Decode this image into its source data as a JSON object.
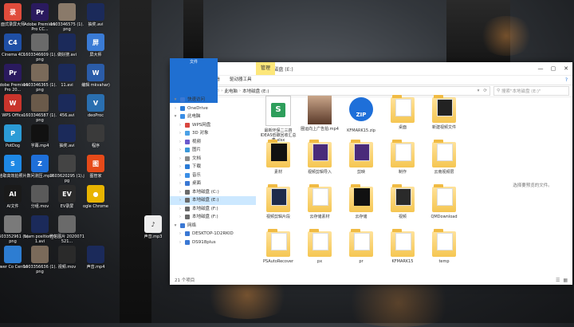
{
  "desktop": {
    "icons": [
      {
        "label": "面式录屏大师",
        "color": "#e04c3c",
        "glyph": "录"
      },
      {
        "label": "Adobe Premiere Pro CC...",
        "color": "#2a1a5e",
        "glyph": "Pr"
      },
      {
        "label": "1603346575 (1).png",
        "color": "#8a7a6a",
        "glyph": ""
      },
      {
        "label": "抽奖.avi",
        "color": "#1b2a5a",
        "glyph": ""
      },
      {
        "label": "Cinema 4D",
        "color": "#1f4fa5",
        "glyph": "C4"
      },
      {
        "label": "1603346609 (1).png",
        "color": "#6a6a6a",
        "glyph": ""
      },
      {
        "label": "做好搜.avi",
        "color": "#1b2a5a",
        "glyph": ""
      },
      {
        "label": "屏大师",
        "color": "#3a7bd5",
        "glyph": "屏"
      },
      {
        "label": "Adobe Premiere Pro 20...",
        "color": "#2a1a5e",
        "glyph": "Pr"
      },
      {
        "label": "1603346365 (1).png",
        "color": "#7a6a5a",
        "glyph": ""
      },
      {
        "label": "11.avi",
        "color": "#1b2a5a",
        "glyph": ""
      },
      {
        "label": "编辑 mkvahar)",
        "color": "#2b5ca8",
        "glyph": "W"
      },
      {
        "label": "WPS Office",
        "color": "#c9342c",
        "glyph": "W"
      },
      {
        "label": "1603346587 (1).png",
        "color": "#6a5a4a",
        "glyph": ""
      },
      {
        "label": "456.avi",
        "color": "#1b2a5a",
        "glyph": ""
      },
      {
        "label": "deoProc",
        "color": "#2a6fb0",
        "glyph": "V"
      },
      {
        "label": "PotDog",
        "color": "#2b9bd6",
        "glyph": "P"
      },
      {
        "label": "字幕.mp4",
        "color": "#111111",
        "glyph": ""
      },
      {
        "label": "抽奖.avi",
        "color": "#1b2a5a",
        "glyph": ""
      },
      {
        "label": "程序",
        "color": "#3a3a3a",
        "glyph": ""
      },
      {
        "label": "拾取高效拍照片",
        "color": "#1e88e5",
        "glyph": "S"
      },
      {
        "label": "数问测压.mp4",
        "color": "#1e6fd9",
        "glyph": "Z"
      },
      {
        "label": "1603620295 (1).jpg",
        "color": "#444444",
        "glyph": ""
      },
      {
        "label": "图管家",
        "color": "#e64a19",
        "glyph": "图"
      },
      {
        "label": "AI文件",
        "color": "#1a1a1a",
        "glyph": "AI"
      },
      {
        "label": "分组.mov",
        "color": "#5a5a5a",
        "glyph": ""
      },
      {
        "label": "EV录屏",
        "color": "#2b2b2b",
        "glyph": "EV"
      },
      {
        "label": "ogle Chrome",
        "color": "#e8b400",
        "glyph": "●"
      },
      {
        "label": "1603352961 (1).png",
        "color": "#7a7a7a",
        "glyph": ""
      },
      {
        "label": "team position_01.avi",
        "color": "#1b2a5a",
        "glyph": ""
      },
      {
        "label": "微信图片 2020071521...",
        "color": "#6a6a6a",
        "glyph": ""
      },
      {
        "label": "声音.mp3",
        "color": "#eeeeee",
        "glyph": "♪"
      },
      {
        "label": "ewer Co Center",
        "color": "#2d7dd2",
        "glyph": ""
      },
      {
        "label": "1603356636 (1).png",
        "color": "#7a6a5a",
        "glyph": ""
      },
      {
        "label": "视频.mov",
        "color": "#2a2a2a",
        "glyph": ""
      },
      {
        "label": "声音.mp4",
        "color": "#1b2a5a",
        "glyph": ""
      }
    ]
  },
  "window": {
    "manage_tab": "管理",
    "title": "本地磁盘 (E:)",
    "quick_access_icons": [
      "save-icon",
      "folder-icon",
      "down-arrow-icon"
    ],
    "controls": [
      "—",
      "▢",
      "✕"
    ],
    "ribbon_tabs": [
      "文件",
      "主页",
      "共享",
      "查看",
      "驱动器工具"
    ],
    "help": "?",
    "address": {
      "segments": [
        "此电脑",
        "本地磁盘 (E:)"
      ],
      "separator": "›"
    },
    "search_placeholder": "搜索\"本地磁盘 (E:)\"",
    "nav": [
      {
        "label": "快速访问",
        "color": "#3a78d4",
        "icon": "star-icon",
        "expanded": true
      },
      {
        "label": "OneDrive",
        "color": "#2a7bd6",
        "icon": "cloud-icon",
        "expanded": false
      },
      {
        "label": "此电脑",
        "color": "#3a8ee6",
        "icon": "computer-icon",
        "expanded": true
      },
      {
        "label": "WPS网盘",
        "color": "#d9463e",
        "icon": "cloud-icon",
        "expanded": false
      },
      {
        "label": "3D 对象",
        "color": "#4aa0e6",
        "icon": "cube-icon",
        "expanded": false
      },
      {
        "label": "视频",
        "color": "#6a5acd",
        "icon": "film-icon",
        "expanded": false
      },
      {
        "label": "图片",
        "color": "#3a98d8",
        "icon": "image-icon",
        "expanded": false
      },
      {
        "label": "文档",
        "color": "#8a8a8a",
        "icon": "document-icon",
        "expanded": false
      },
      {
        "label": "下载",
        "color": "#2a7bd6",
        "icon": "download-icon",
        "expanded": false
      },
      {
        "label": "音乐",
        "color": "#3a8ee6",
        "icon": "music-icon",
        "expanded": false
      },
      {
        "label": "桌面",
        "color": "#3a78d4",
        "icon": "desktop-icon",
        "expanded": false
      },
      {
        "label": "本地磁盘 (C:)",
        "color": "#6a6a6a",
        "icon": "disk-icon",
        "expanded": false
      },
      {
        "label": "本地磁盘 (E:)",
        "color": "#6a6a6a",
        "icon": "disk-icon",
        "expanded": false,
        "selected": true
      },
      {
        "label": "本地磁盘 (F:)",
        "color": "#6a6a6a",
        "icon": "disk-icon",
        "expanded": false
      },
      {
        "label": "本地磁盘 (F:)",
        "color": "#6a6a6a",
        "icon": "disk-icon",
        "expanded": false
      },
      {
        "label": "网络",
        "color": "#3a78d4",
        "icon": "network-icon",
        "expanded": true
      },
      {
        "label": "DESKTOP-1D2RKID",
        "color": "#3a78d4",
        "icon": "computer-icon",
        "expanded": false
      },
      {
        "label": "DS918plus",
        "color": "#3a78d4",
        "icon": "computer-icon",
        "expanded": false
      }
    ],
    "files": [
      {
        "name": "最新环保二三四  IDEAS低碳回收汇总表.xlsx",
        "kind": "xlsx"
      },
      {
        "name": "圈运向上广告拍.mp4",
        "kind": "video"
      },
      {
        "name": "KFMARK15.zip",
        "kind": "zip"
      },
      {
        "name": "桌面",
        "kind": "folder"
      },
      {
        "name": "新建视频文件",
        "kind": "folder-dark"
      },
      {
        "name": "素材",
        "kind": "folder-black"
      },
      {
        "name": "视频剪辑导入",
        "kind": "folder-purple"
      },
      {
        "name": "剪映",
        "kind": "folder-purple"
      },
      {
        "name": "制作",
        "kind": "folder"
      },
      {
        "name": "云南视频层",
        "kind": "folder"
      },
      {
        "name": "视频剪辑片段",
        "kind": "folder-navy"
      },
      {
        "name": "云存储素材",
        "kind": "folder"
      },
      {
        "name": "云存储",
        "kind": "folder-black"
      },
      {
        "name": "视频",
        "kind": "folder-black2"
      },
      {
        "name": "QMDownload",
        "kind": "folder"
      },
      {
        "name": "PSAutoRecover",
        "kind": "folder"
      },
      {
        "name": "px",
        "kind": "folder"
      },
      {
        "name": "pr",
        "kind": "folder"
      },
      {
        "name": "KFMARK15",
        "kind": "folder"
      },
      {
        "name": "temp",
        "kind": "folder"
      }
    ],
    "preview_message": "选择要预览的文件。",
    "status": "21 个项目"
  }
}
